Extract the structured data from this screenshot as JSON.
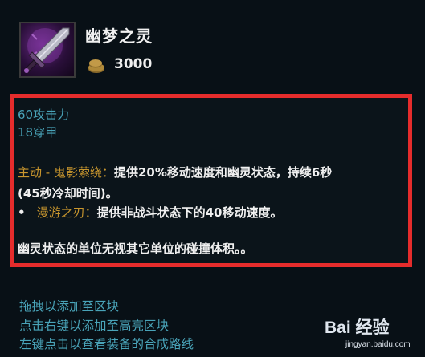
{
  "item": {
    "name": "幽梦之灵",
    "icon": "ghostblade-sword-icon",
    "price_icon": "gold-coin-icon",
    "price": "3000"
  },
  "stats": [
    "60攻击力",
    "18穿甲"
  ],
  "active": {
    "label": "主动 - 鬼影萦绕：",
    "text_line1": "提供20%移动速度和幽灵状态，持续6秒",
    "text_line2": "(45秒冷却时间)。"
  },
  "passive": {
    "bullet": "•",
    "label": "漫游之刃：",
    "text": "提供非战斗状态下的40移动速度。"
  },
  "note": "幽灵状态的单位无视其它单位的碰撞体积。。",
  "hints": [
    "拖拽以添加至区块",
    "点击右键以添加至高亮区块",
    "左键点击以查看装备的合成路线"
  ],
  "watermark": {
    "main": "Bai 经验",
    "sub": "jingyan.baidu.com"
  },
  "colors": {
    "background": "#081016",
    "highlight_border": "#e52c2c",
    "stat_text": "#49a3b8",
    "ability_label": "#c8962e"
  }
}
